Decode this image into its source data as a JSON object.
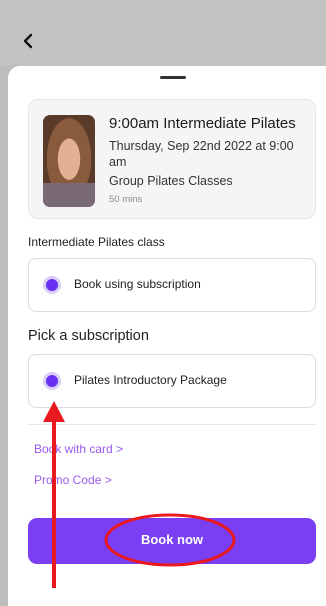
{
  "nav": {
    "back_icon": "chevron-left-icon"
  },
  "class": {
    "title": "9:00am Intermediate Pilates",
    "date": "Thursday, Sep 22nd 2022 at 9:00 am",
    "group": "Group Pilates Classes",
    "duration": "50 mins"
  },
  "booking": {
    "section_label": "Intermediate Pilates class",
    "option_label": "Book using subscription",
    "pick_heading": "Pick a subscription",
    "subscription_label": "Pilates Introductory Package",
    "book_with_card": "Book with card >",
    "promo_code": "Promo Code >",
    "book_now": "Book now"
  },
  "colors": {
    "accent": "#7a3ff2",
    "link": "#9b59f0",
    "annotation": "#e8191f"
  }
}
